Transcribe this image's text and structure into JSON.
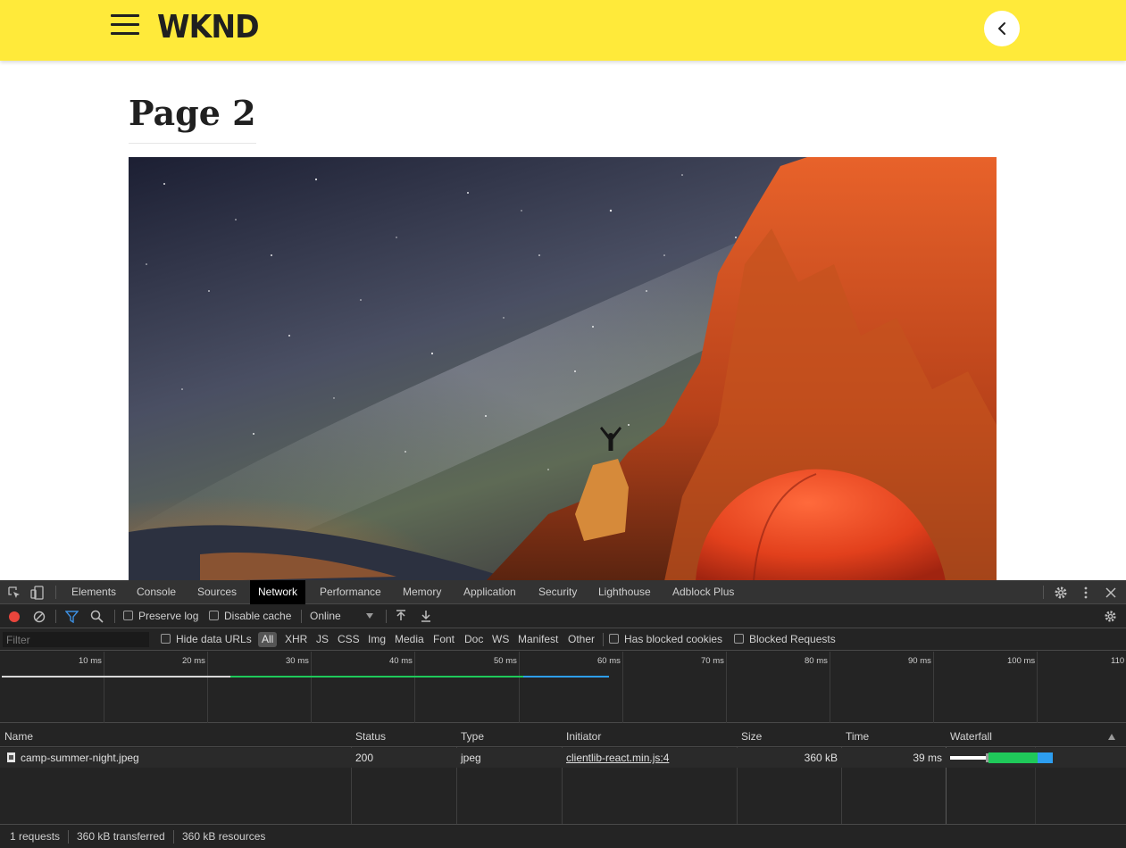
{
  "site": {
    "logo": "WKND",
    "brand_color": "#ffea3a"
  },
  "page": {
    "title": "Page 2",
    "hero_image": {
      "subject": "camp-summer-night"
    }
  },
  "devtools": {
    "tabs": [
      "Elements",
      "Console",
      "Sources",
      "Network",
      "Performance",
      "Memory",
      "Application",
      "Security",
      "Lighthouse",
      "Adblock Plus"
    ],
    "active_tab": "Network",
    "toolbar": {
      "preserve_log": "Preserve log",
      "disable_cache": "Disable cache",
      "throttling": "Online"
    },
    "filter": {
      "placeholder": "Filter",
      "hide_data_urls": "Hide data URLs",
      "types": [
        "All",
        "XHR",
        "JS",
        "CSS",
        "Img",
        "Media",
        "Font",
        "Doc",
        "WS",
        "Manifest",
        "Other"
      ],
      "has_blocked_cookies": "Has blocked cookies",
      "blocked_requests": "Blocked Requests"
    },
    "overview": {
      "ticks": [
        "10 ms",
        "20 ms",
        "30 ms",
        "40 ms",
        "50 ms",
        "60 ms",
        "70 ms",
        "80 ms",
        "90 ms",
        "100 ms",
        "110"
      ]
    },
    "columns": [
      "Name",
      "Status",
      "Type",
      "Initiator",
      "Size",
      "Time",
      "Waterfall"
    ],
    "requests": [
      {
        "name": "camp-summer-night.jpeg",
        "status": "200",
        "type": "jpeg",
        "initiator": "clientlib-react.min.js:4",
        "size": "360 kB",
        "time": "39 ms"
      }
    ],
    "summary": {
      "requests": "1 requests",
      "transferred": "360 kB transferred",
      "resources": "360 kB resources"
    },
    "colors": {
      "waiting": "#1fc95a",
      "download": "#2d9ef0",
      "record": "#e8453c",
      "filter_active": "#3d8fe0"
    }
  }
}
